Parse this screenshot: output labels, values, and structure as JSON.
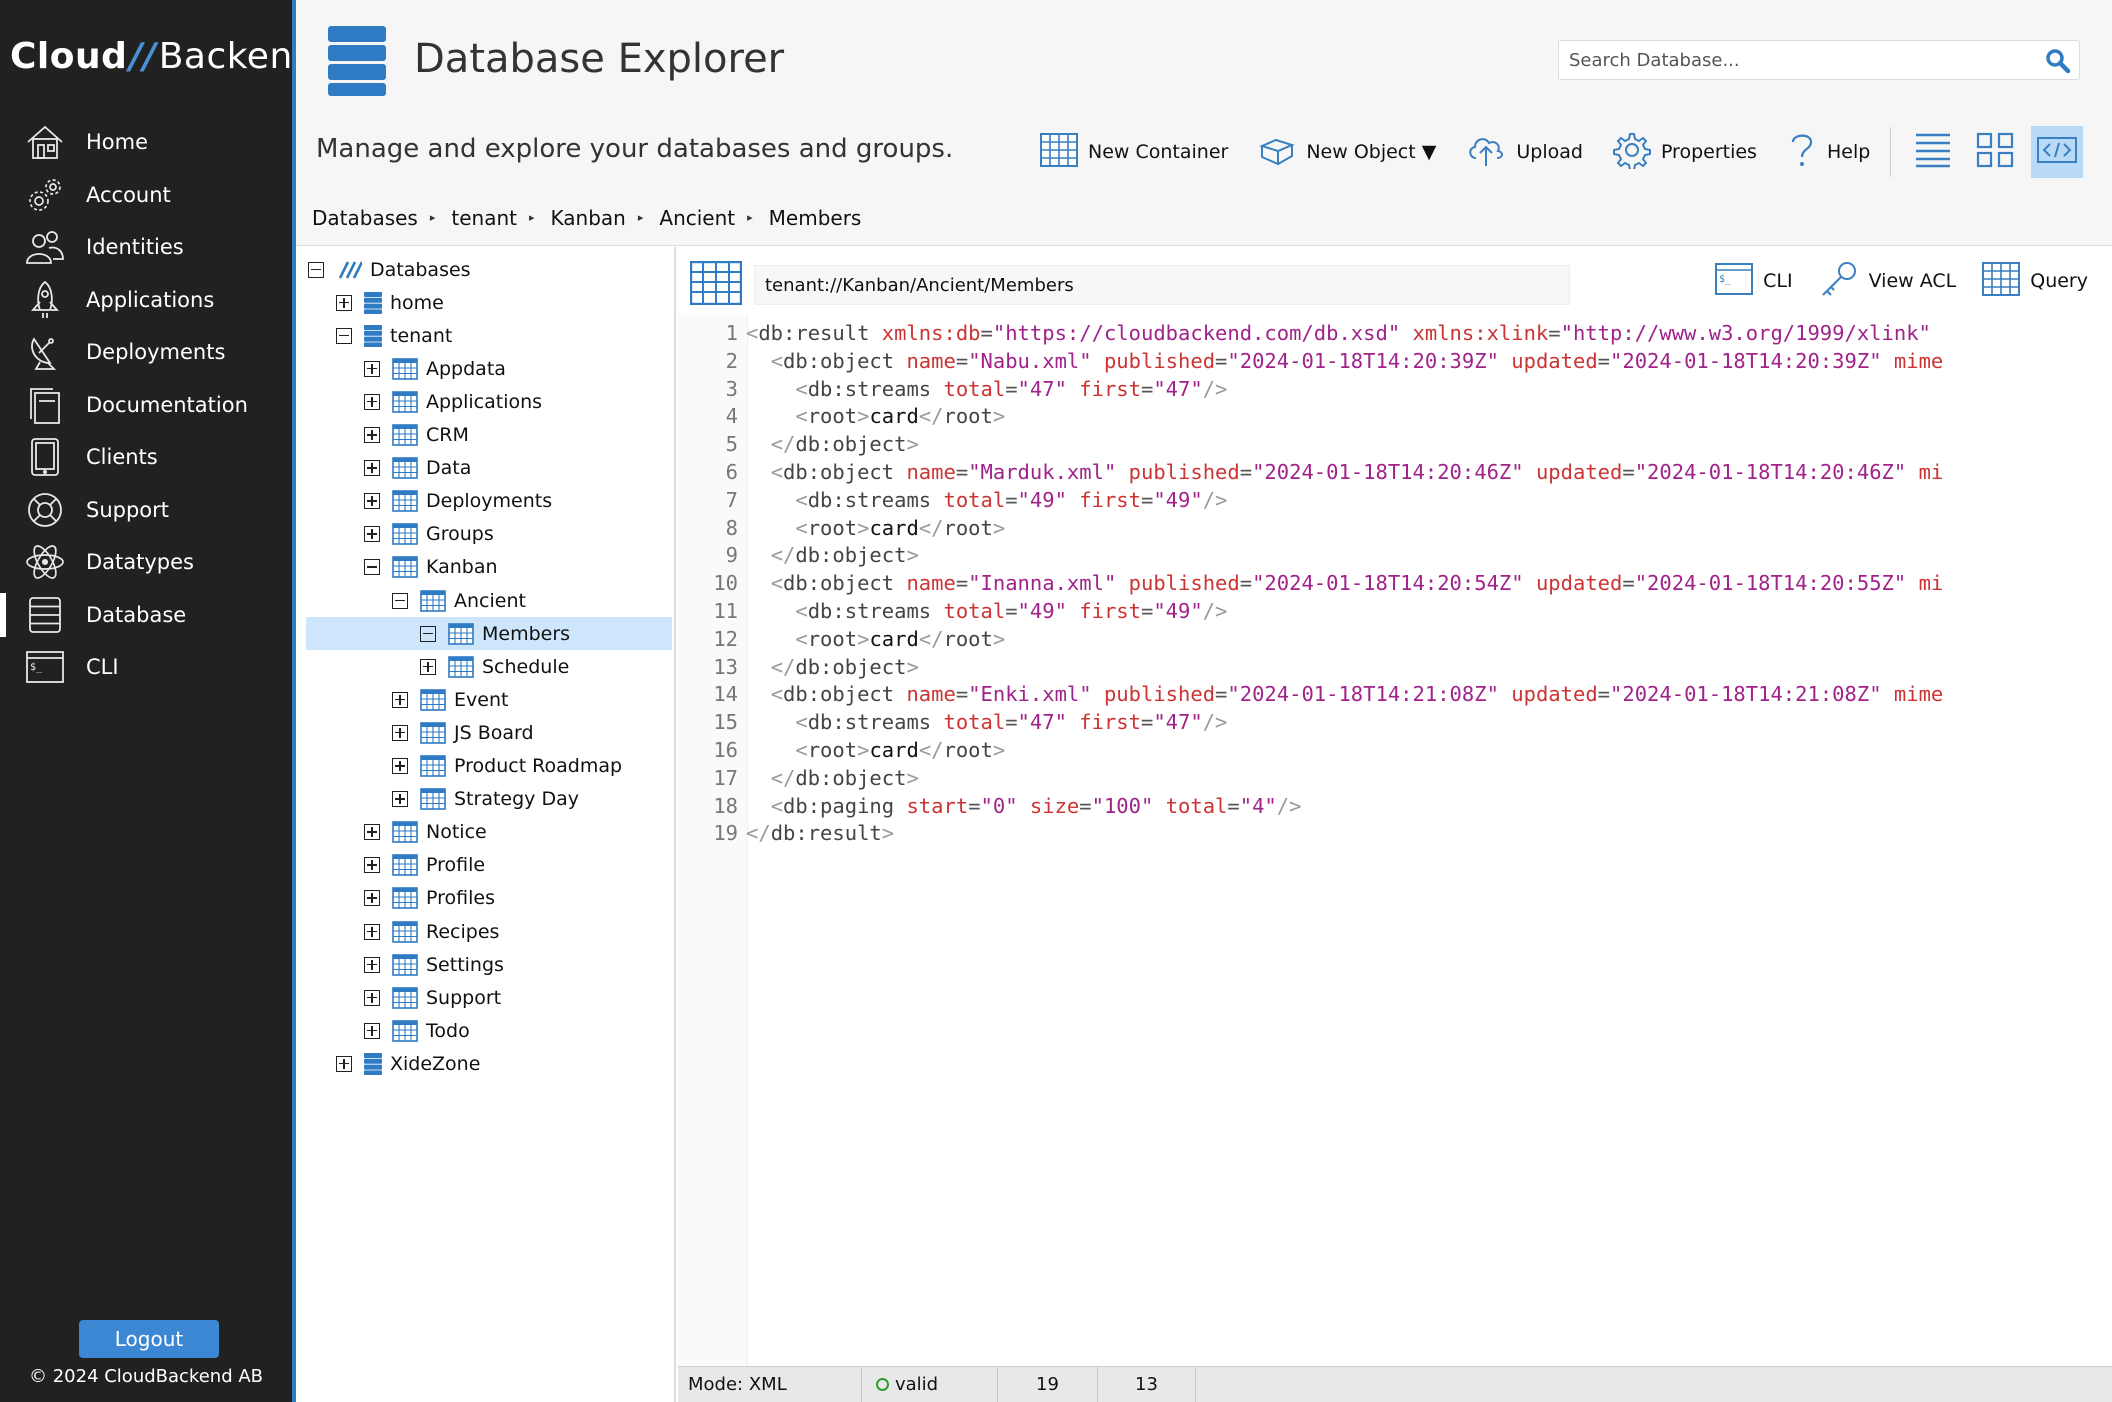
{
  "brand": {
    "part1": "Cloud",
    "slashes": "//",
    "part2": "Backend"
  },
  "sidebar": {
    "items": [
      {
        "label": "Home",
        "icon": "home-icon",
        "active": false
      },
      {
        "label": "Account",
        "icon": "gears-icon",
        "active": false
      },
      {
        "label": "Identities",
        "icon": "users-icon",
        "active": false
      },
      {
        "label": "Applications",
        "icon": "rocket-icon",
        "active": false
      },
      {
        "label": "Deployments",
        "icon": "satellite-dish-icon",
        "active": false
      },
      {
        "label": "Documentation",
        "icon": "documents-icon",
        "active": false
      },
      {
        "label": "Clients",
        "icon": "tablet-icon",
        "active": false
      },
      {
        "label": "Support",
        "icon": "lifebuoy-icon",
        "active": false
      },
      {
        "label": "Datatypes",
        "icon": "atom-icon",
        "active": false
      },
      {
        "label": "Database",
        "icon": "database-icon",
        "active": true
      },
      {
        "label": "CLI",
        "icon": "terminal-icon",
        "active": false
      }
    ],
    "logout_label": "Logout",
    "copyright": "© 2024 CloudBackend AB"
  },
  "header": {
    "title": "Database Explorer",
    "subtitle": "Manage and explore your databases and groups.",
    "search_placeholder": "Search Database...",
    "toolbar": {
      "new_container": "New Container",
      "new_object": "New Object ▼",
      "upload": "Upload",
      "properties": "Properties",
      "help": "Help"
    },
    "views": [
      "list-view-icon",
      "grid-view-icon",
      "code-view-icon"
    ],
    "active_view": "code-view-icon"
  },
  "breadcrumb": [
    "Databases",
    "tenant",
    "Kanban",
    "Ancient",
    "Members"
  ],
  "tree": [
    {
      "label": "Databases",
      "level": 0,
      "toggle": "minus",
      "icon": "databases-root-icon"
    },
    {
      "label": "home",
      "level": 1,
      "toggle": "plus",
      "icon": "database-icon"
    },
    {
      "label": "tenant",
      "level": 1,
      "toggle": "minus",
      "icon": "database-icon"
    },
    {
      "label": "Appdata",
      "level": 2,
      "toggle": "plus",
      "icon": "table-icon"
    },
    {
      "label": "Applications",
      "level": 2,
      "toggle": "plus",
      "icon": "table-icon"
    },
    {
      "label": "CRM",
      "level": 2,
      "toggle": "plus",
      "icon": "table-icon"
    },
    {
      "label": "Data",
      "level": 2,
      "toggle": "plus",
      "icon": "table-icon"
    },
    {
      "label": "Deployments",
      "level": 2,
      "toggle": "plus",
      "icon": "table-icon"
    },
    {
      "label": "Groups",
      "level": 2,
      "toggle": "plus",
      "icon": "table-icon"
    },
    {
      "label": "Kanban",
      "level": 2,
      "toggle": "minus",
      "icon": "table-icon"
    },
    {
      "label": "Ancient",
      "level": 3,
      "toggle": "minus",
      "icon": "table-icon"
    },
    {
      "label": "Members",
      "level": 4,
      "toggle": "minus",
      "icon": "table-icon",
      "selected": true
    },
    {
      "label": "Schedule",
      "level": 4,
      "toggle": "plus",
      "icon": "table-icon"
    },
    {
      "label": "Event",
      "level": 3,
      "toggle": "plus",
      "icon": "table-icon"
    },
    {
      "label": "JS Board",
      "level": 3,
      "toggle": "plus",
      "icon": "table-icon"
    },
    {
      "label": "Product Roadmap",
      "level": 3,
      "toggle": "plus",
      "icon": "table-icon"
    },
    {
      "label": "Strategy Day",
      "level": 3,
      "toggle": "plus",
      "icon": "table-icon"
    },
    {
      "label": "Notice",
      "level": 2,
      "toggle": "plus",
      "icon": "table-icon"
    },
    {
      "label": "Profile",
      "level": 2,
      "toggle": "plus",
      "icon": "table-icon"
    },
    {
      "label": "Profiles",
      "level": 2,
      "toggle": "plus",
      "icon": "table-icon"
    },
    {
      "label": "Recipes",
      "level": 2,
      "toggle": "plus",
      "icon": "table-icon"
    },
    {
      "label": "Settings",
      "level": 2,
      "toggle": "plus",
      "icon": "table-icon"
    },
    {
      "label": "Support",
      "level": 2,
      "toggle": "plus",
      "icon": "table-icon"
    },
    {
      "label": "Todo",
      "level": 2,
      "toggle": "plus",
      "icon": "table-icon"
    },
    {
      "label": "XideZone",
      "level": 1,
      "toggle": "plus",
      "icon": "database-icon"
    }
  ],
  "editor": {
    "path": "tenant://Kanban/Ancient/Members",
    "actions": {
      "cli": "CLI",
      "view_acl": "View ACL",
      "query": "Query"
    },
    "lines": [
      [
        [
          "br",
          "<"
        ],
        [
          "tag",
          "db:result"
        ],
        [
          "txt",
          " "
        ],
        [
          "attr",
          "xmlns:db"
        ],
        [
          "eq",
          "="
        ],
        [
          "val",
          "\"https://cloudbackend.com/db.xsd\""
        ],
        [
          "txt",
          " "
        ],
        [
          "attr",
          "xmlns:xlink"
        ],
        [
          "eq",
          "="
        ],
        [
          "val",
          "\"http://www.w3.org/1999/xlink\""
        ]
      ],
      [
        [
          "txt",
          "  "
        ],
        [
          "br",
          "<"
        ],
        [
          "tag",
          "db:object"
        ],
        [
          "txt",
          " "
        ],
        [
          "attr",
          "name"
        ],
        [
          "eq",
          "="
        ],
        [
          "val",
          "\"Nabu.xml\""
        ],
        [
          "txt",
          " "
        ],
        [
          "attr",
          "published"
        ],
        [
          "eq",
          "="
        ],
        [
          "val",
          "\"2024-01-18T14:20:39Z\""
        ],
        [
          "txt",
          " "
        ],
        [
          "attr",
          "updated"
        ],
        [
          "eq",
          "="
        ],
        [
          "val",
          "\"2024-01-18T14:20:39Z\""
        ],
        [
          "txt",
          " "
        ],
        [
          "attr",
          "mime"
        ]
      ],
      [
        [
          "txt",
          "    "
        ],
        [
          "br",
          "<"
        ],
        [
          "tag",
          "db:streams"
        ],
        [
          "txt",
          " "
        ],
        [
          "attr",
          "total"
        ],
        [
          "eq",
          "="
        ],
        [
          "val",
          "\"47\""
        ],
        [
          "txt",
          " "
        ],
        [
          "attr",
          "first"
        ],
        [
          "eq",
          "="
        ],
        [
          "val",
          "\"47\""
        ],
        [
          "br",
          "/>"
        ]
      ],
      [
        [
          "txt",
          "    "
        ],
        [
          "br",
          "<"
        ],
        [
          "tag",
          "root"
        ],
        [
          "br",
          ">"
        ],
        [
          "txt",
          "card"
        ],
        [
          "br",
          "</"
        ],
        [
          "tag",
          "root"
        ],
        [
          "br",
          ">"
        ]
      ],
      [
        [
          "txt",
          "  "
        ],
        [
          "br",
          "</"
        ],
        [
          "tag",
          "db:object"
        ],
        [
          "br",
          ">"
        ]
      ],
      [
        [
          "txt",
          "  "
        ],
        [
          "br",
          "<"
        ],
        [
          "tag",
          "db:object"
        ],
        [
          "txt",
          " "
        ],
        [
          "attr",
          "name"
        ],
        [
          "eq",
          "="
        ],
        [
          "val",
          "\"Marduk.xml\""
        ],
        [
          "txt",
          " "
        ],
        [
          "attr",
          "published"
        ],
        [
          "eq",
          "="
        ],
        [
          "val",
          "\"2024-01-18T14:20:46Z\""
        ],
        [
          "txt",
          " "
        ],
        [
          "attr",
          "updated"
        ],
        [
          "eq",
          "="
        ],
        [
          "val",
          "\"2024-01-18T14:20:46Z\""
        ],
        [
          "txt",
          " "
        ],
        [
          "attr",
          "mi"
        ]
      ],
      [
        [
          "txt",
          "    "
        ],
        [
          "br",
          "<"
        ],
        [
          "tag",
          "db:streams"
        ],
        [
          "txt",
          " "
        ],
        [
          "attr",
          "total"
        ],
        [
          "eq",
          "="
        ],
        [
          "val",
          "\"49\""
        ],
        [
          "txt",
          " "
        ],
        [
          "attr",
          "first"
        ],
        [
          "eq",
          "="
        ],
        [
          "val",
          "\"49\""
        ],
        [
          "br",
          "/>"
        ]
      ],
      [
        [
          "txt",
          "    "
        ],
        [
          "br",
          "<"
        ],
        [
          "tag",
          "root"
        ],
        [
          "br",
          ">"
        ],
        [
          "txt",
          "card"
        ],
        [
          "br",
          "</"
        ],
        [
          "tag",
          "root"
        ],
        [
          "br",
          ">"
        ]
      ],
      [
        [
          "txt",
          "  "
        ],
        [
          "br",
          "</"
        ],
        [
          "tag",
          "db:object"
        ],
        [
          "br",
          ">"
        ]
      ],
      [
        [
          "txt",
          "  "
        ],
        [
          "br",
          "<"
        ],
        [
          "tag",
          "db:object"
        ],
        [
          "txt",
          " "
        ],
        [
          "attr",
          "name"
        ],
        [
          "eq",
          "="
        ],
        [
          "val",
          "\"Inanna.xml\""
        ],
        [
          "txt",
          " "
        ],
        [
          "attr",
          "published"
        ],
        [
          "eq",
          "="
        ],
        [
          "val",
          "\"2024-01-18T14:20:54Z\""
        ],
        [
          "txt",
          " "
        ],
        [
          "attr",
          "updated"
        ],
        [
          "eq",
          "="
        ],
        [
          "val",
          "\"2024-01-18T14:20:55Z\""
        ],
        [
          "txt",
          " "
        ],
        [
          "attr",
          "mi"
        ]
      ],
      [
        [
          "txt",
          "    "
        ],
        [
          "br",
          "<"
        ],
        [
          "tag",
          "db:streams"
        ],
        [
          "txt",
          " "
        ],
        [
          "attr",
          "total"
        ],
        [
          "eq",
          "="
        ],
        [
          "val",
          "\"49\""
        ],
        [
          "txt",
          " "
        ],
        [
          "attr",
          "first"
        ],
        [
          "eq",
          "="
        ],
        [
          "val",
          "\"49\""
        ],
        [
          "br",
          "/>"
        ]
      ],
      [
        [
          "txt",
          "    "
        ],
        [
          "br",
          "<"
        ],
        [
          "tag",
          "root"
        ],
        [
          "br",
          ">"
        ],
        [
          "txt",
          "card"
        ],
        [
          "br",
          "</"
        ],
        [
          "tag",
          "root"
        ],
        [
          "br",
          ">"
        ]
      ],
      [
        [
          "txt",
          "  "
        ],
        [
          "br",
          "</"
        ],
        [
          "tag",
          "db:object"
        ],
        [
          "br",
          ">"
        ]
      ],
      [
        [
          "txt",
          "  "
        ],
        [
          "br",
          "<"
        ],
        [
          "tag",
          "db:object"
        ],
        [
          "txt",
          " "
        ],
        [
          "attr",
          "name"
        ],
        [
          "eq",
          "="
        ],
        [
          "val",
          "\"Enki.xml\""
        ],
        [
          "txt",
          " "
        ],
        [
          "attr",
          "published"
        ],
        [
          "eq",
          "="
        ],
        [
          "val",
          "\"2024-01-18T14:21:08Z\""
        ],
        [
          "txt",
          " "
        ],
        [
          "attr",
          "updated"
        ],
        [
          "eq",
          "="
        ],
        [
          "val",
          "\"2024-01-18T14:21:08Z\""
        ],
        [
          "txt",
          " "
        ],
        [
          "attr",
          "mime"
        ]
      ],
      [
        [
          "txt",
          "    "
        ],
        [
          "br",
          "<"
        ],
        [
          "tag",
          "db:streams"
        ],
        [
          "txt",
          " "
        ],
        [
          "attr",
          "total"
        ],
        [
          "eq",
          "="
        ],
        [
          "val",
          "\"47\""
        ],
        [
          "txt",
          " "
        ],
        [
          "attr",
          "first"
        ],
        [
          "eq",
          "="
        ],
        [
          "val",
          "\"47\""
        ],
        [
          "br",
          "/>"
        ]
      ],
      [
        [
          "txt",
          "    "
        ],
        [
          "br",
          "<"
        ],
        [
          "tag",
          "root"
        ],
        [
          "br",
          ">"
        ],
        [
          "txt",
          "card"
        ],
        [
          "br",
          "</"
        ],
        [
          "tag",
          "root"
        ],
        [
          "br",
          ">"
        ]
      ],
      [
        [
          "txt",
          "  "
        ],
        [
          "br",
          "</"
        ],
        [
          "tag",
          "db:object"
        ],
        [
          "br",
          ">"
        ]
      ],
      [
        [
          "txt",
          "  "
        ],
        [
          "br",
          "<"
        ],
        [
          "tag",
          "db:paging"
        ],
        [
          "txt",
          " "
        ],
        [
          "attr",
          "start"
        ],
        [
          "eq",
          "="
        ],
        [
          "val",
          "\"0\""
        ],
        [
          "txt",
          " "
        ],
        [
          "attr",
          "size"
        ],
        [
          "eq",
          "="
        ],
        [
          "val",
          "\"100\""
        ],
        [
          "txt",
          " "
        ],
        [
          "attr",
          "total"
        ],
        [
          "eq",
          "="
        ],
        [
          "val",
          "\"4\""
        ],
        [
          "br",
          "/>"
        ]
      ],
      [
        [
          "br",
          "</"
        ],
        [
          "tag",
          "db:result"
        ],
        [
          "br",
          ">"
        ]
      ]
    ]
  },
  "status": {
    "mode": "Mode: XML",
    "validity": "valid",
    "line": "19",
    "column": "13"
  },
  "colors": {
    "accent": "#2f7bc4",
    "sidebar_bg": "#212121",
    "selected_row": "#cde6fb",
    "valid": "#2aa02a"
  }
}
